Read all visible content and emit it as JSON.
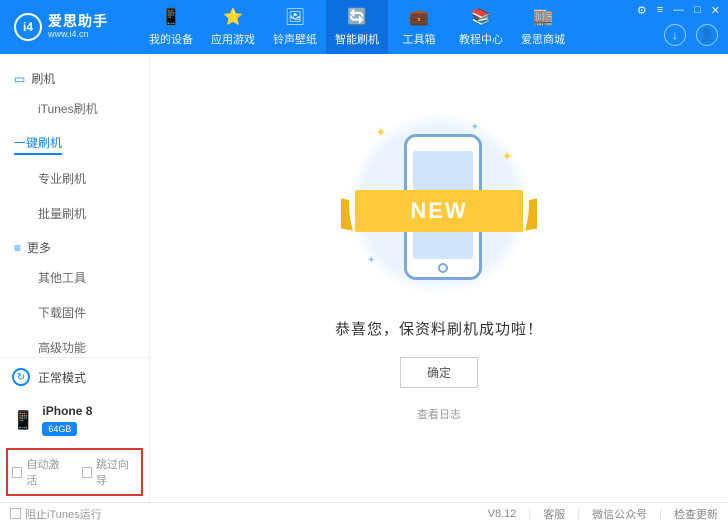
{
  "brand": {
    "title": "爱思助手",
    "sub": "www.i4.cn",
    "logo": "i4"
  },
  "nav": [
    {
      "label": "我的设备",
      "icon": "📱"
    },
    {
      "label": "应用游戏",
      "icon": "⭐"
    },
    {
      "label": "铃声壁纸",
      "icon": "🖼"
    },
    {
      "label": "智能刷机",
      "icon": "🔄"
    },
    {
      "label": "工具箱",
      "icon": "💼"
    },
    {
      "label": "教程中心",
      "icon": "📚"
    },
    {
      "label": "爱思商城",
      "icon": "🏬"
    }
  ],
  "nav_active_index": 3,
  "top_icons": {
    "download": "↓",
    "user": "👤"
  },
  "win_ctrl": [
    "⚙",
    "≡",
    "—",
    "□",
    "✕"
  ],
  "sidebar": {
    "groups": [
      {
        "icon": "▭",
        "title": "刷机",
        "items": [
          "iTunes刷机",
          "一键刷机",
          "专业刷机",
          "批量刷机"
        ],
        "active_index": 1
      },
      {
        "icon": "≡",
        "title": "更多",
        "items": [
          "其他工具",
          "下载固件",
          "高级功能"
        ],
        "active_index": -1
      }
    ],
    "mode": {
      "label": "正常模式",
      "icon": "↻"
    },
    "device": {
      "name": "iPhone 8",
      "storage": "64GB",
      "icon": "📱"
    },
    "checks": [
      {
        "label": "自动激活"
      },
      {
        "label": "跳过向导"
      }
    ]
  },
  "main": {
    "ribbon": "NEW",
    "success": "恭喜您，保资料刷机成功啦！",
    "ok": "确定",
    "log": "查看日志"
  },
  "statusbar": {
    "block_itunes": "阻止iTunes运行",
    "version": "V8.12",
    "links": [
      "客服",
      "微信公众号",
      "检查更新"
    ]
  }
}
